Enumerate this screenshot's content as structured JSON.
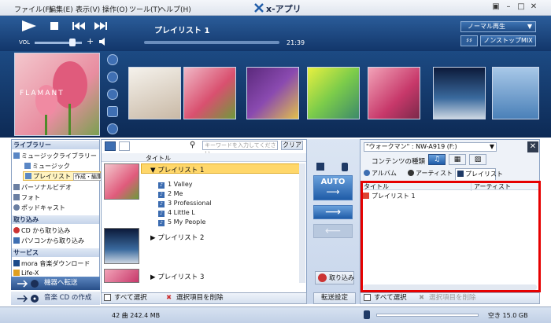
{
  "menu": {
    "items": [
      "ファイル(F)",
      "編集(E)",
      "表示(V)",
      "操作(O)",
      "ツール(T)",
      "ヘルプ(H)"
    ],
    "app_title": "x-アプリ"
  },
  "player": {
    "vol_label": "VOL",
    "playlist_title": "プレイリスト 1",
    "time": "21:39",
    "mode": "ノーマル再生",
    "nonstop": "ノンストップMIX"
  },
  "library": {
    "header": "ライブラリー",
    "music_library": "ミュージックライブラリー",
    "music": "ミュージック",
    "playlist": "プレイリスト",
    "create_edit": "作成・編集",
    "personal_video": "パーソナルビデオ",
    "photo": "フォト",
    "podcast": "ポッドキャスト",
    "import_header": "取り込み",
    "from_cd": "CD から取り込み",
    "from_pc": "パソコンから取り込み",
    "service_header": "サービス",
    "mora": "mora 音楽ダウンロード",
    "life_x": "Life-X",
    "send_to_device": "機器へ転送",
    "cd_create": "音楽 CD の作成"
  },
  "content": {
    "search_placeholder": "キーワードを入力してください",
    "clear": "クリア",
    "title_col": "タイトル",
    "playlist1": "プレイリスト 1",
    "playlist2": "プレイリスト 2",
    "playlist3": "プレイリスト 3",
    "songs": [
      "1 Valley",
      "2 Me",
      "3 Professional",
      "4 Little L",
      "5 My People"
    ],
    "select_all": "すべて選択",
    "delete_selected": "選択項目を削除",
    "status": "42 曲  242.4 MB"
  },
  "transfer": {
    "auto": "AUTO",
    "import": "取り込み",
    "settings": "転送設定"
  },
  "device": {
    "name": "\"ウォークマン\" : NW-A919 (F:)",
    "content_type": "コンテンツの種類",
    "tab_album": "アルバム",
    "tab_artist": "アーティスト",
    "tab_playlist": "プレイリスト",
    "col_title": "タイトル",
    "col_artist": "アーティスト",
    "row1": "プレイリスト 1",
    "select_all": "すべて選択",
    "delete_selected": "選択項目を削除",
    "free_space": "空き 15.0 GB"
  },
  "covers": {
    "main_text": "FLAMANT"
  },
  "colors": {
    "accent": "#1f5ca8",
    "highlight": "#ffd76a",
    "frame": "#e60000"
  }
}
